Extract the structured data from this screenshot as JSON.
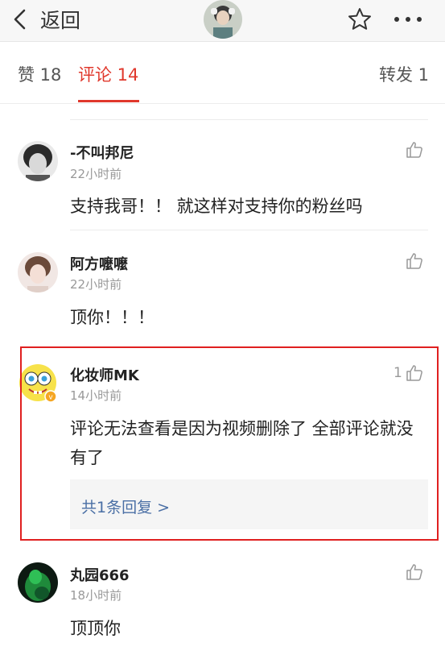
{
  "header": {
    "back_label": "返回"
  },
  "tabs": {
    "likes": "赞 18",
    "comments": "评论 14",
    "reposts": "转发 1"
  },
  "comments": [
    {
      "name": "-不叫邦尼",
      "time": "22小时前",
      "text": "支持我哥！！ 就这样对支持你的粉丝吗",
      "likes": ""
    },
    {
      "name": "阿方嚒嚒",
      "time": "22小时前",
      "text": "顶你！！！",
      "likes": ""
    },
    {
      "name": "化妆师MK",
      "time": "14小时前",
      "text": "评论无法查看是因为视频删除了 全部评论就没有了",
      "likes": "1",
      "reply_link": "共1条回复 >"
    },
    {
      "name": "丸园666",
      "time": "18小时前",
      "text": "顶顶你",
      "likes": ""
    }
  ],
  "colors": {
    "accent": "#e0382c",
    "link": "#4a6fa5",
    "highlight_border": "#e02020"
  }
}
